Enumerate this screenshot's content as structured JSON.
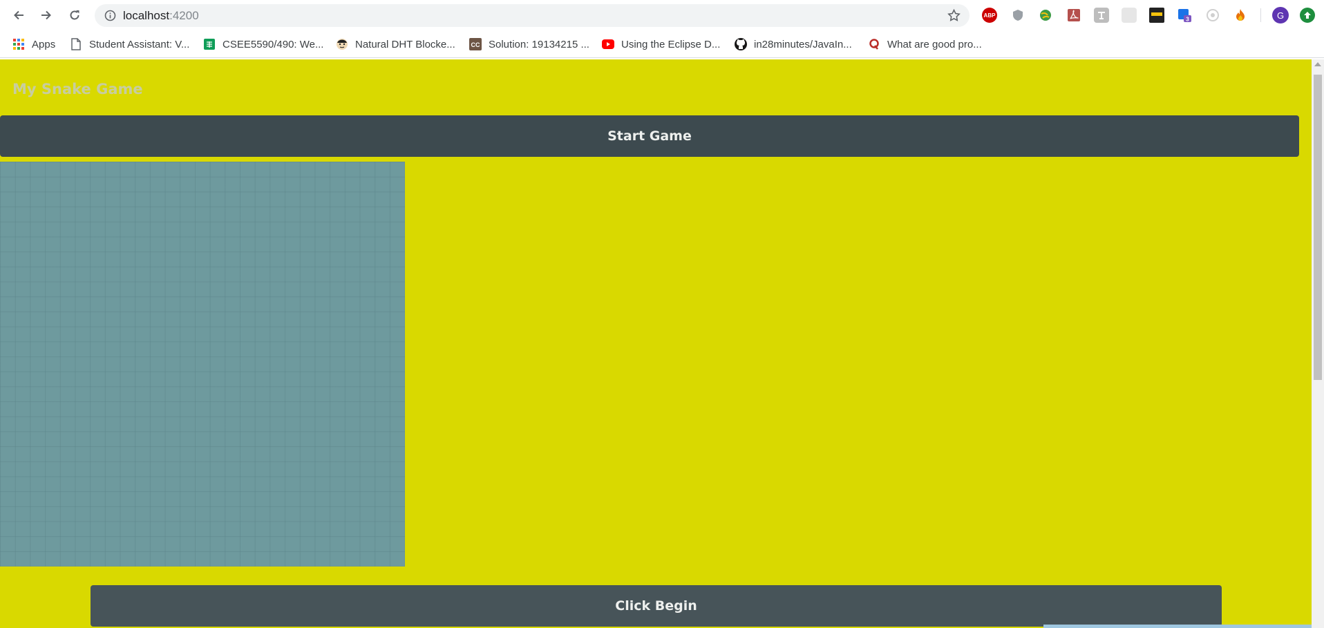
{
  "browser": {
    "url_host": "localhost",
    "url_port": ":4200",
    "extensions": [
      {
        "name": "adblock-plus-icon",
        "text": "ABP",
        "color": "#cc0000"
      },
      {
        "name": "shield-extension-icon",
        "text": "",
        "color": "#9aa0a6"
      },
      {
        "name": "globe-extension-icon",
        "text": "",
        "color": "#3d9b45"
      },
      {
        "name": "pdf-extension-icon",
        "text": "",
        "color": "#b5504d"
      },
      {
        "name": "translate-extension-icon",
        "text": "",
        "color": "#bdbdbd"
      },
      {
        "name": "blank-extension-icon",
        "text": "",
        "color": "#e0e0e0"
      },
      {
        "name": "video-quality-extension-icon",
        "text": "",
        "color": "#222222"
      },
      {
        "name": "notification-extension-icon",
        "text": "3",
        "color": "#1a73e8"
      },
      {
        "name": "eye-extension-icon",
        "text": "",
        "color": "#d0d0d0"
      },
      {
        "name": "fire-extension-icon",
        "text": "",
        "color": "#e8710a"
      }
    ],
    "profile_initial": "G"
  },
  "bookmarks": [
    {
      "label": "Apps",
      "icon": "apps-grid-icon"
    },
    {
      "label": "Student Assistant: V...",
      "icon": "document-icon"
    },
    {
      "label": "CSEE5590/490: We...",
      "icon": "sheets-icon"
    },
    {
      "label": "Natural DHT Blocke...",
      "icon": "avatar-icon"
    },
    {
      "label": "Solution: 19134215 ...",
      "icon": "cc-icon"
    },
    {
      "label": "Using the Eclipse D...",
      "icon": "youtube-icon"
    },
    {
      "label": "in28minutes/JavaIn...",
      "icon": "github-icon"
    },
    {
      "label": "What are good pro...",
      "icon": "quora-icon"
    }
  ],
  "page": {
    "title": "My Snake Game",
    "start_button": "Start Game",
    "begin_button": "Click Begin"
  },
  "colors": {
    "page_background": "#d9d900",
    "board": "#6e9a9e",
    "button_dark": "#3d4a4f"
  }
}
